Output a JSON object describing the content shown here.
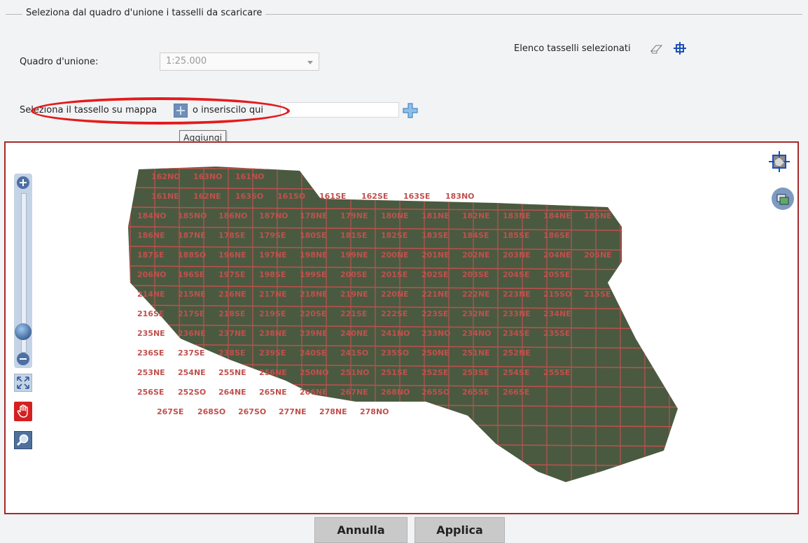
{
  "fieldset": {
    "legend": "Seleziona dal quadro d'unione i tasselli da scaricare"
  },
  "form": {
    "quadro_label": "Quadro d'unione:",
    "quadro_value": "1:25.000",
    "selected_list_label": "Elenco tasselli selezionati",
    "select_tile_text": "Seleziona il tassello su mappa",
    "or_insert_text": "o inseriscilo qui",
    "tile_input_value": ""
  },
  "tooltip": {
    "text": "Aggiungi"
  },
  "map": {
    "tile_color": "#c0504d",
    "imagery_color": "#4a5a40",
    "tile_labels": [
      "162NO",
      "163NO",
      "161NO",
      "161NE",
      "162NE",
      "163SO",
      "161SO",
      "161SE",
      "162SE",
      "163SE",
      "183NO",
      "184NO",
      "185NO",
      "186NO",
      "187NO",
      "178NE",
      "179NE",
      "180NE",
      "181NE",
      "182NE",
      "183NE",
      "184NE",
      "185NE",
      "186NE",
      "187NE",
      "178SE",
      "179SE",
      "180SE",
      "181SE",
      "182SE",
      "183SE",
      "184SE",
      "185SE",
      "186SE",
      "187SE",
      "188SO",
      "196NE",
      "197NE",
      "198NE",
      "199NE",
      "200NE",
      "201NE",
      "202NE",
      "203NE",
      "204NE",
      "205NE",
      "206NO",
      "196SE",
      "197SE",
      "198SE",
      "199SE",
      "200SE",
      "201SE",
      "202SE",
      "203SE",
      "204SE",
      "205SE",
      "214NE",
      "215NE",
      "216NE",
      "217NE",
      "218NE",
      "219NE",
      "220NE",
      "221NE",
      "222NE",
      "223NE",
      "215SO",
      "215SE",
      "216SE",
      "217SE",
      "218SE",
      "219SE",
      "220SE",
      "221SE",
      "222SE",
      "223SE",
      "232NE",
      "233NE",
      "234NE",
      "235NE",
      "236NE",
      "237NE",
      "238NE",
      "239NE",
      "240NE",
      "241NO",
      "233NO",
      "234NO",
      "234SE",
      "235SE",
      "236SE",
      "237SE",
      "238SE",
      "239SE",
      "240SE",
      "241SO",
      "235SO",
      "250NE",
      "251NE",
      "252NE",
      "253NE",
      "254NE",
      "255NE",
      "256NE",
      "250NO",
      "251NO",
      "251SE",
      "252SE",
      "253SE",
      "254SE",
      "255SE",
      "256SE",
      "252SO",
      "264NE",
      "265NE",
      "266NE",
      "267NE",
      "268NO",
      "265SO",
      "265SE",
      "266SE",
      "267SE",
      "268SO",
      "267SO",
      "277NE",
      "278NE",
      "278NO"
    ]
  },
  "toolbar": {
    "zoom_in_icon": "plus-icon",
    "zoom_out_icon": "minus-icon",
    "zoom_level": 0.07,
    "extent_icon": "expand-arrows-icon",
    "pan_icon": "hand-icon",
    "zoom_box_icon": "magnifier-icon"
  },
  "buttons": {
    "cancel": "Annulla",
    "apply": "Applica"
  }
}
